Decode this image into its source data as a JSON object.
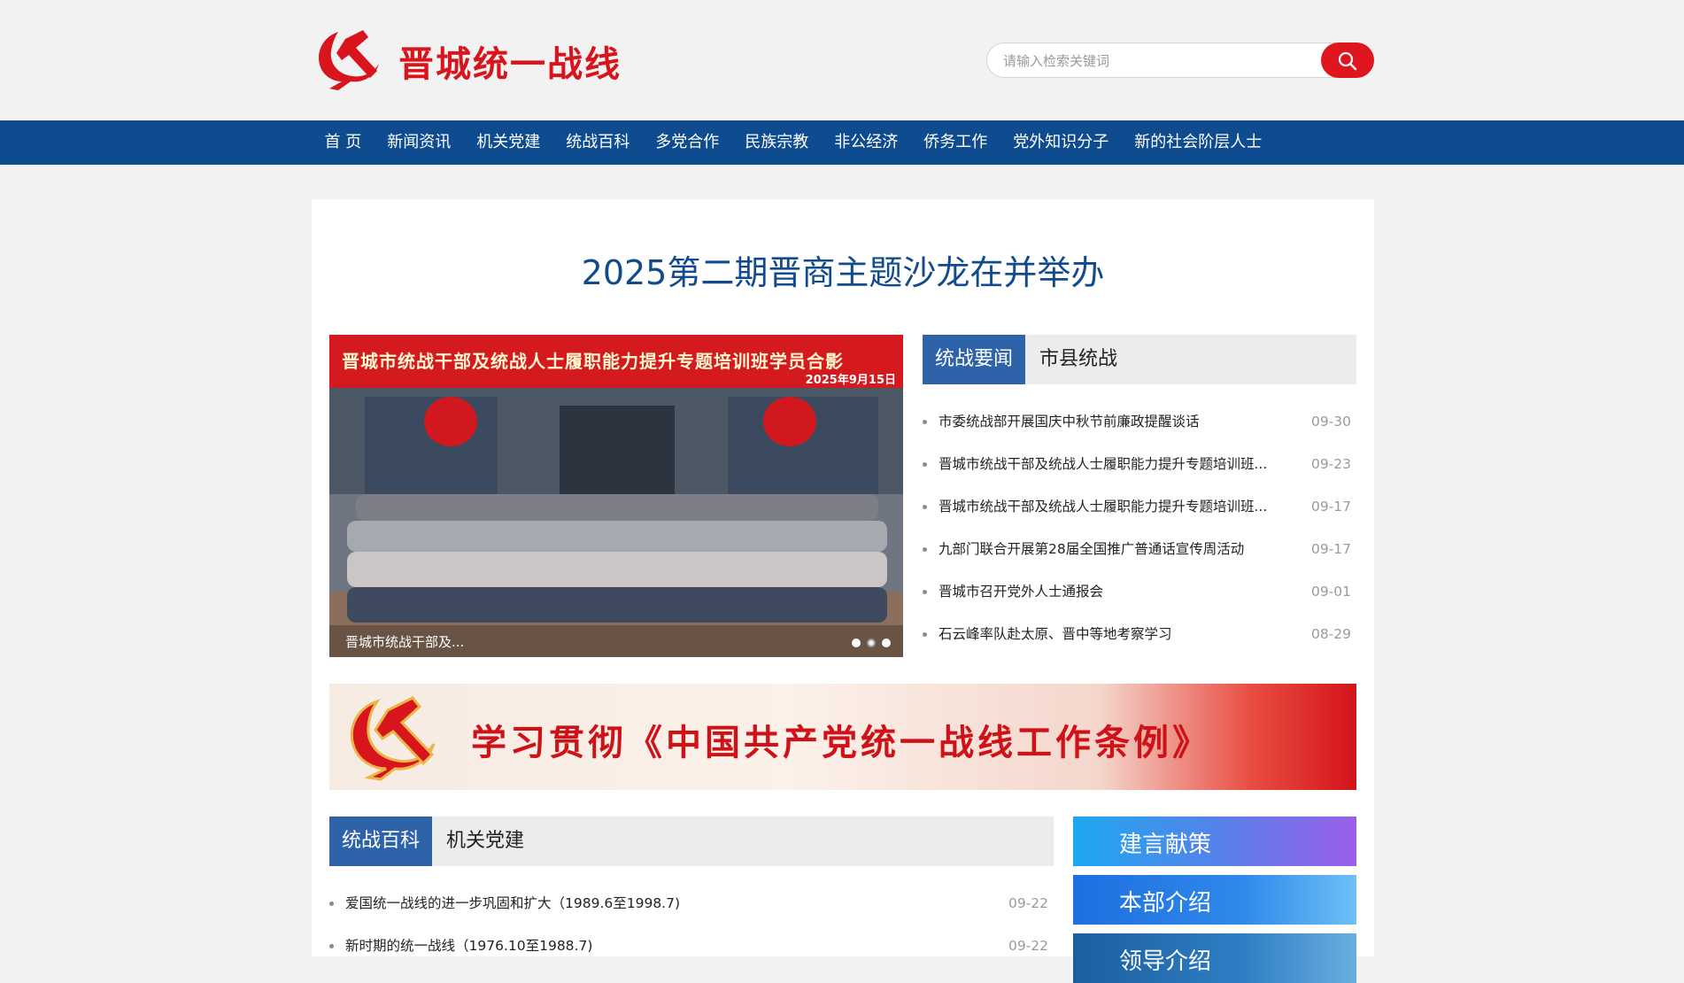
{
  "header": {
    "site_title": "晋城统一战线",
    "search_placeholder": "请输入检索关键词",
    "colors": {
      "brand_red": "#d8141c",
      "nav_blue": "#0f4c8f"
    }
  },
  "nav": {
    "items": [
      "首 页",
      "新闻资讯",
      "机关党建",
      "统战百科",
      "多党合作",
      "民族宗教",
      "非公经济",
      "侨务工作",
      "党外知识分子",
      "新的社会阶层人士"
    ]
  },
  "main": {
    "headline": "2025第二期晋商主题沙龙在并举办",
    "slider": {
      "banner_title": "晋城市统战干部及统战人士履职能力提升专题培训班学员合影",
      "banner_date": "2025年9月15日",
      "caption": "晋城市统战干部及...",
      "dot_count": 3,
      "active_dot": 1
    },
    "news_panel": {
      "tabs": [
        "统战要闻",
        "市县统战"
      ],
      "active_tab": 0,
      "items": [
        {
          "title": "市委统战部开展国庆中秋节前廉政提醒谈话",
          "date": "09-30"
        },
        {
          "title": "晋城市统战干部及统战人士履职能力提升专题培训班...",
          "date": "09-23"
        },
        {
          "title": "晋城市统战干部及统战人士履职能力提升专题培训班...",
          "date": "09-17"
        },
        {
          "title": "九部门联合开展第28届全国推广普通话宣传周活动",
          "date": "09-17"
        },
        {
          "title": "晋城市召开党外人士通报会",
          "date": "09-01"
        },
        {
          "title": "石云峰率队赴太原、晋中等地考察学习",
          "date": "08-29"
        }
      ]
    },
    "promo_banner": {
      "text": "学习贯彻《中国共产党统一战线工作条例》"
    },
    "bottom_panel": {
      "tabs": [
        "统战百科",
        "机关党建"
      ],
      "active_tab": 0,
      "items": [
        {
          "title": "爱国统一战线的进一步巩固和扩大（1989.6至1998.7)",
          "date": "09-22"
        },
        {
          "title": "新时期的统一战线（1976.10至1988.7)",
          "date": "09-22"
        }
      ]
    },
    "side_buttons": [
      "建言献策",
      "本部介绍",
      "领导介绍"
    ]
  }
}
